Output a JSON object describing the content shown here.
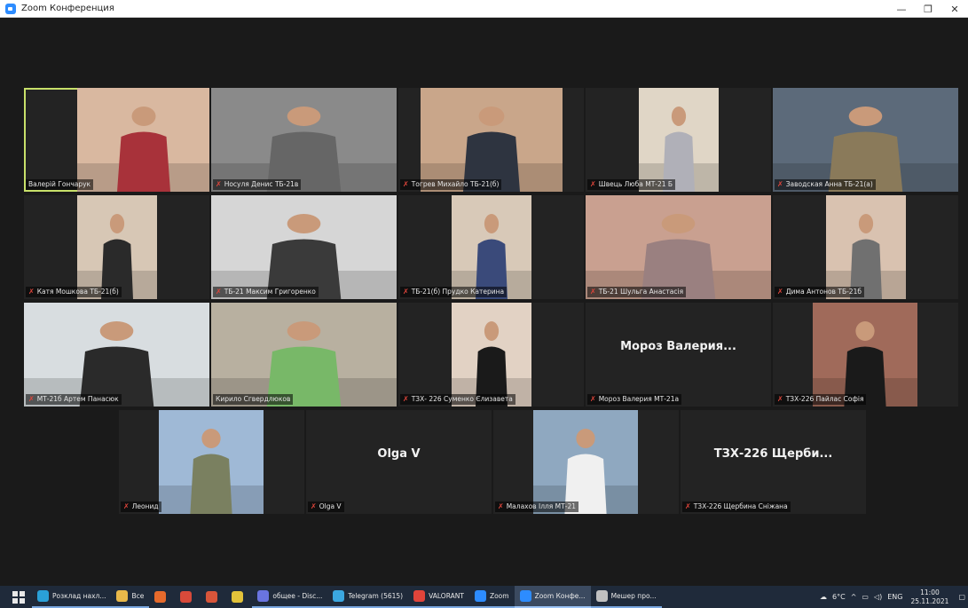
{
  "window": {
    "title": "Zoom Конференция",
    "controls": [
      "—",
      "❐",
      "✕"
    ]
  },
  "participants": [
    {
      "name": "Валерій Гончарук",
      "muted": false,
      "video": true,
      "active": true
    },
    {
      "name": "Носуля Денис ТБ-21в",
      "muted": true,
      "video": true
    },
    {
      "name": "Тогрев Михайло ТБ-21(б)",
      "muted": true,
      "video": true
    },
    {
      "name": "Швець Люба МТ-21 Б",
      "muted": true,
      "video": true
    },
    {
      "name": "Заводская Анна ТБ-21(а)",
      "muted": true,
      "video": true
    },
    {
      "name": "Катя Мошкова ТБ-21(б)",
      "muted": true,
      "video": true
    },
    {
      "name": "ТБ-21 Максим Григоренко",
      "muted": true,
      "video": true
    },
    {
      "name": "ТБ-21(б) Прудко Катерина",
      "muted": true,
      "video": true
    },
    {
      "name": "ТБ-21 Шульга Анастасія",
      "muted": true,
      "video": true
    },
    {
      "name": "Дима Антонов ТБ-21б",
      "muted": true,
      "video": true
    },
    {
      "name": "МТ-21б Артем Панасюк",
      "muted": true,
      "video": true
    },
    {
      "name": "Кирило Сгвердлюков",
      "muted": false,
      "video": true
    },
    {
      "name": "ТЗХ- 226 Суменко Єлизавета",
      "muted": true,
      "video": true
    },
    {
      "name": "Мороз Валерия МТ-21а",
      "muted": true,
      "video": false,
      "display": "Мороз Валерия..."
    },
    {
      "name": "ТЗХ-226 Пайлас Софія",
      "muted": true,
      "video": true
    },
    {
      "name": "Леонид",
      "muted": true,
      "video": true
    },
    {
      "name": "Olga V",
      "muted": true,
      "video": false,
      "display": "Olga V"
    },
    {
      "name": "Малахов Ілля МТ-21",
      "muted": true,
      "video": true
    },
    {
      "name": "ТЗХ-226 Щербина Сніжана",
      "muted": true,
      "video": false,
      "display": "ТЗХ-226 Щерби..."
    }
  ],
  "taskbar": {
    "items": [
      {
        "label": "Розклад нахл...",
        "icon": "edge-icon",
        "color": "#2aa0d8"
      },
      {
        "label": "Все",
        "icon": "folder-icon",
        "color": "#e8b84a"
      },
      {
        "label": "",
        "icon": "firefox-icon",
        "color": "#e66a2c"
      },
      {
        "label": "",
        "icon": "app-red-icon",
        "color": "#d84a3a"
      },
      {
        "label": "",
        "icon": "app-tool-icon",
        "color": "#d8553a"
      },
      {
        "label": "",
        "icon": "app-yellow-icon",
        "color": "#e2c23a"
      },
      {
        "label": "общее - Disc...",
        "icon": "discord-icon",
        "color": "#6a74e0"
      },
      {
        "label": "Telegram (5615)",
        "icon": "telegram-icon",
        "color": "#3ba7e0"
      },
      {
        "label": "VALORANT",
        "icon": "valorant-icon",
        "color": "#e0443a"
      },
      {
        "label": "Zoom",
        "icon": "zoom-icon",
        "color": "#2d8cff"
      },
      {
        "label": "Zoom Конфе...",
        "icon": "zoom-icon",
        "color": "#2d8cff",
        "selected": true
      },
      {
        "label": "Мешер про...",
        "icon": "messenger-icon",
        "color": "#c0c0c0"
      }
    ],
    "weather": "6°C",
    "language": "ENG",
    "time": "11:00",
    "date": "25.11.2021"
  }
}
